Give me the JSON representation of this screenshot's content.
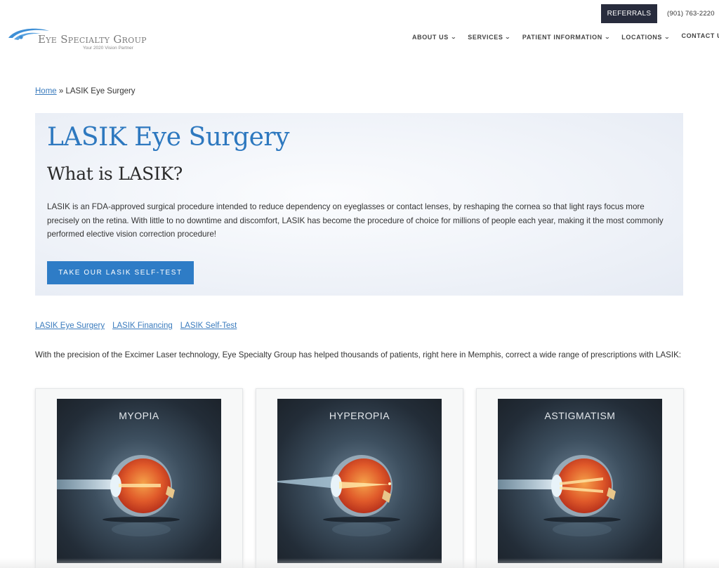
{
  "header": {
    "logo": {
      "name": "Eye Specialty Group",
      "tagline": "Your 2020 Vision Partner"
    },
    "referrals_label": "REFERRALS",
    "phone": "(901) 763-2220",
    "nav": [
      {
        "label": "ABOUT US",
        "has_dropdown": true
      },
      {
        "label": "SERVICES",
        "has_dropdown": true
      },
      {
        "label": "PATIENT INFORMATION",
        "has_dropdown": true
      },
      {
        "label": "LOCATIONS",
        "has_dropdown": true
      },
      {
        "label": "CONTACT US",
        "has_dropdown": false
      }
    ],
    "chevron_glyph": "⌄"
  },
  "breadcrumb": {
    "home": "Home",
    "separator": " » ",
    "current": "LASIK Eye Surgery"
  },
  "hero": {
    "title": "LASIK Eye Surgery",
    "subtitle": "What is LASIK?",
    "text": "LASIK is an FDA-approved surgical procedure intended to reduce dependency on eyeglasses or contact lenses, by reshaping the cornea so that light rays focus more precisely on the retina. With little to no downtime and discomfort, LASIK has become the procedure of choice for millions of people each year, making it the most commonly performed elective vision correction procedure!",
    "button_label": "TAKE OUR LASIK SELF-TEST"
  },
  "sublinks": [
    "LASIK Eye Surgery",
    "LASIK Financing",
    "LASIK Self-Test"
  ],
  "intro": "With the precision of the Excimer Laser technology, Eye Specialty Group has helped thousands of patients, right here in Memphis, correct a wide range of prescriptions with LASIK:",
  "cards": [
    {
      "label": "MYOPIA",
      "image": "myopia-eye-diagram"
    },
    {
      "label": "HYPEROPIA",
      "image": "hyperopia-eye-diagram"
    },
    {
      "label": "ASTIGMATISM",
      "image": "astigmatism-eye-diagram"
    }
  ],
  "colors": {
    "brand_blue": "#2e7cc6",
    "title_blue": "#2d78bf",
    "link_blue": "#3a7bbd",
    "referrals_bg": "#282c3d"
  }
}
